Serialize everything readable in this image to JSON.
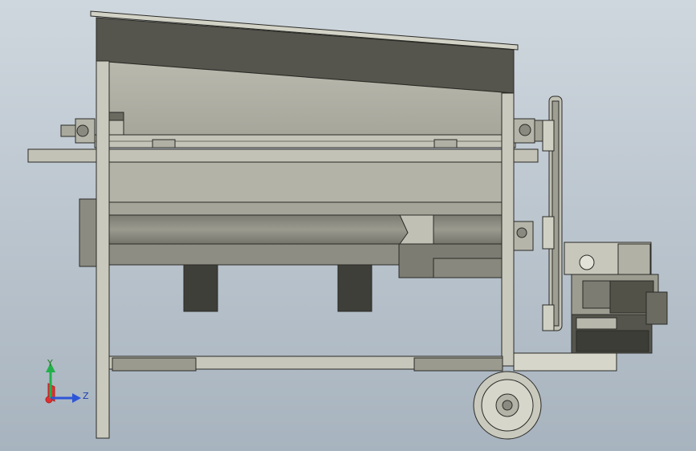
{
  "viewport": {
    "background_top": "#c9d2da",
    "background_bottom": "#a9b5c0",
    "model_colors": {
      "frame": "#c9c9bd",
      "panel_dark": "#5a5a52",
      "panel_mid": "#8e8e84",
      "outline": "#2a2a26",
      "chute": "#3f3f3a"
    }
  },
  "triad": {
    "y_label": "Y",
    "z_label": "Z",
    "x_color": "#e03030",
    "y_color": "#22b04a",
    "z_color": "#2d55d8"
  }
}
